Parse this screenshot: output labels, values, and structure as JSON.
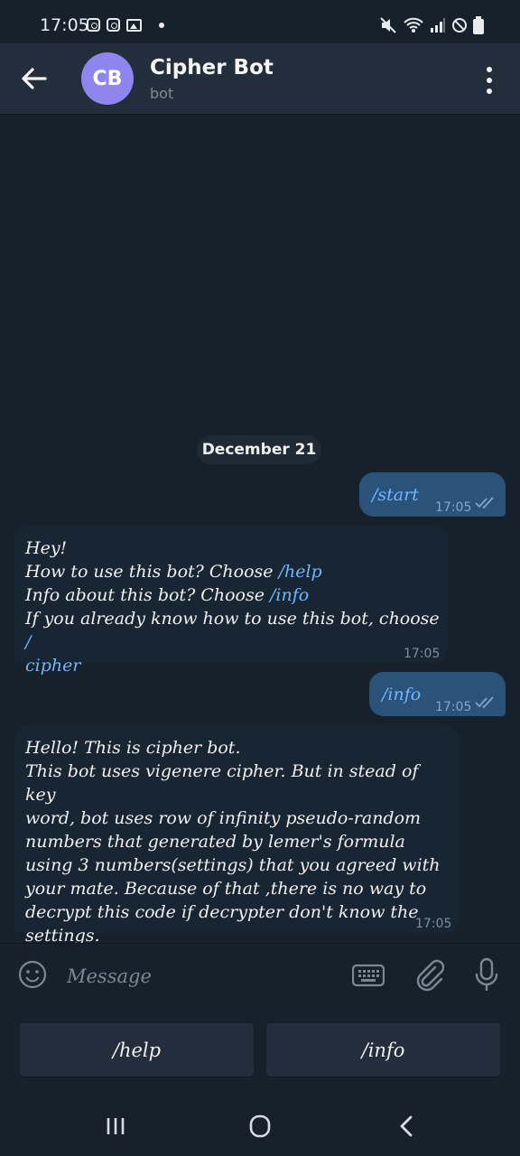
{
  "status_bar": {
    "time": "17:05"
  },
  "header": {
    "avatar_initials": "CB",
    "title": "Cipher Bot",
    "subtitle": "bot"
  },
  "chat": {
    "date_label": "December 21",
    "messages": [
      {
        "direction": "outgoing",
        "text": "/start",
        "time": "17:05",
        "read": true
      },
      {
        "direction": "incoming",
        "lines": [
          "Hey!",
          "How to use this bot? Choose ",
          "/help",
          "Info about this bot? Choose ",
          "/info",
          "If you already know how to use this bot, choose ",
          "/",
          "cipher"
        ],
        "time": "17:05"
      },
      {
        "direction": "outgoing",
        "text": "/info",
        "time": "17:05",
        "read": true
      },
      {
        "direction": "incoming",
        "text_lines": [
          "Hello! This is cipher bot.",
          "This bot uses vigenere cipher. But in stead of key",
          "word, bot uses row of infinity pseudo-random",
          "numbers that generated by lemer's formula",
          "using 3 numbers(settings) that you agreed with",
          "your mate. Because of that ,there is no way to",
          "decrypt this code if decrypter don't know the",
          "settings."
        ],
        "time": "17:05"
      }
    ]
  },
  "composer": {
    "placeholder": "Message"
  },
  "bot_keyboard": {
    "buttons": [
      "/help",
      "/info"
    ]
  },
  "colors": {
    "background": "#17212b",
    "header": "#232e3c",
    "outgoing_bubble": "#2b5278",
    "incoming_bubble": "#182533",
    "link": "#6fb7ff",
    "avatar": "#8e85ee"
  }
}
